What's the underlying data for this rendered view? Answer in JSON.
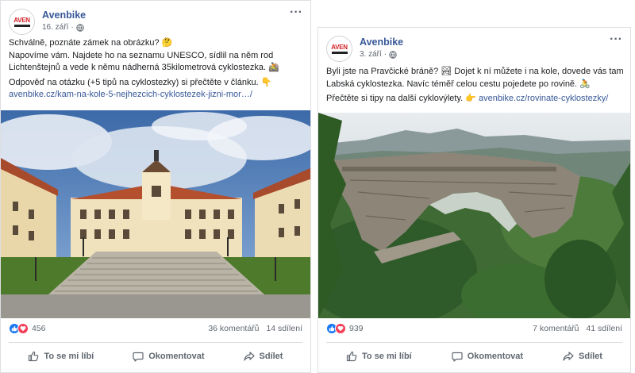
{
  "posts": [
    {
      "page_name": "Avenbike",
      "date": "16. září",
      "logo_text": "AVEN",
      "text_line1": "Schválně, poznáte zámek na obrázku? 🤔",
      "text_line2": "Napovíme vám. Najdete ho na seznamu UNESCO, sídlil na něm rod Lichtenštejnů a vede k němu nádherná 35kilometrová cyklostezka. 🚵",
      "text_line3": "Odpověď na otázku (+5 tipů na cyklostezky) si přečtěte v článku. 👇",
      "link": "avenbike.cz/kam-na-kole-5-nejhezcich-cyklostezek-jizni-mor…/",
      "photo_description_icon": "chateau-photo",
      "reaction_count": "456",
      "comments": "36 komentářů",
      "shares": "14 sdílení"
    },
    {
      "page_name": "Avenbike",
      "date": "3. září",
      "logo_text": "AVEN",
      "text_line1": "Byli jste na Pravčické bráně? 🏞 Dojet k ní můžete i na kole, dovede vás tam Labská cyklostezka. Navíc téměř celou cestu pojedete po rovině. 🚴",
      "text_line2_prefix": "Přečtěte si tipy na další cyklovýlety. 👉 ",
      "link": "avenbike.cz/rovinate-cyklostezky/",
      "photo_description_icon": "rock-arch-photo",
      "reaction_count": "939",
      "comments": "7 komentářů",
      "shares": "41 sdílení"
    }
  ],
  "actions": {
    "like": "To se mi líbí",
    "comment": "Okomentovat",
    "share": "Sdílet"
  },
  "colors": {
    "link": "#385898",
    "like_blue": "#1877f2",
    "love_red": "#f33e58",
    "muted": "#606770"
  }
}
